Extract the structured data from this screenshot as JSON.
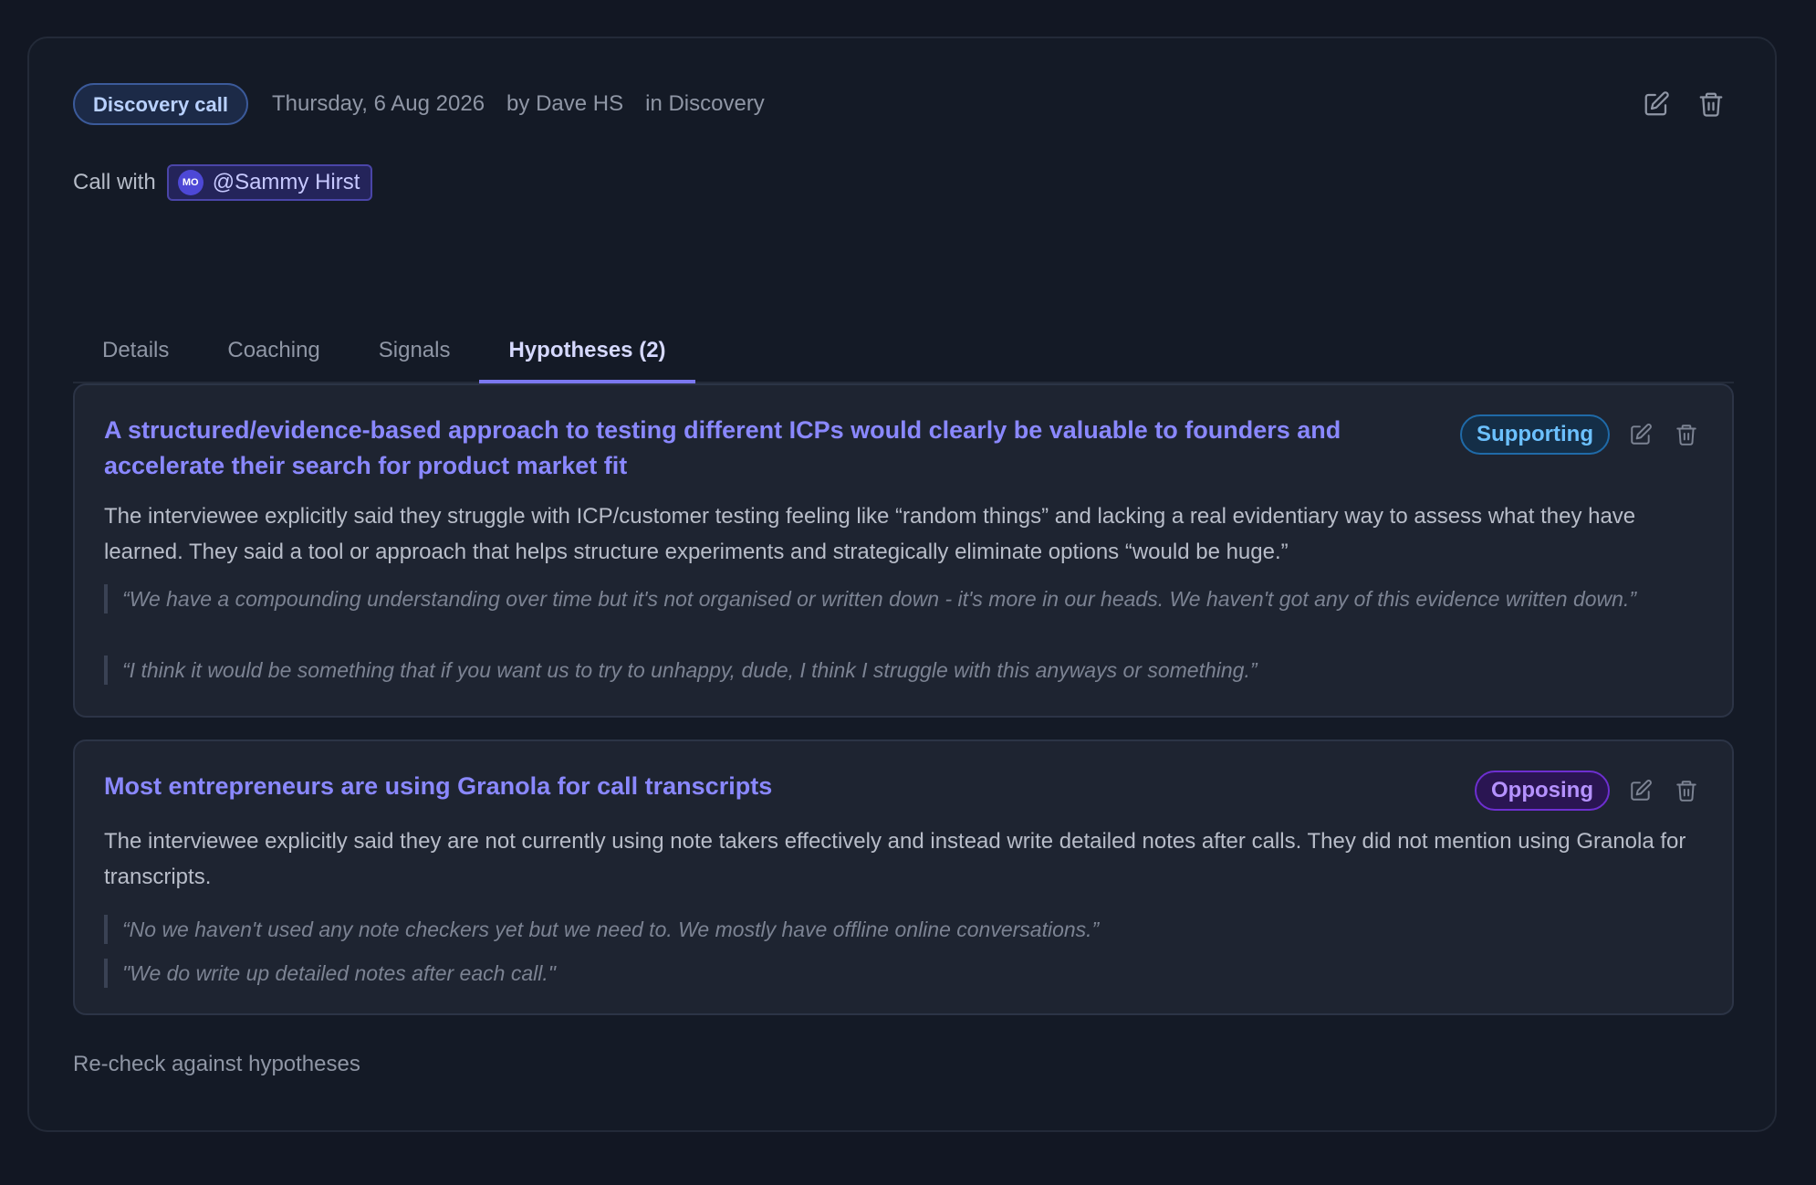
{
  "header": {
    "type_label": "Discovery call",
    "date": "Thursday, 6 Aug 2026",
    "author": "by Dave HS",
    "stage": "in Discovery"
  },
  "call_with": {
    "label": "Call with",
    "avatar_initials": "MO",
    "person": "@Sammy Hirst"
  },
  "tabs": [
    {
      "label": "Details"
    },
    {
      "label": "Coaching"
    },
    {
      "label": "Signals"
    },
    {
      "label": "Hypotheses (2)",
      "active": true
    }
  ],
  "hypotheses": [
    {
      "title": "A structured/evidence-based approach to testing different ICPs would clearly be valuable to founders and accelerate their search for product market fit",
      "stance": "Supporting",
      "summary": "The interviewee explicitly said they struggle with ICP/customer testing feeling like “random things” and lacking a real evidentiary way to assess what they have learned. They said a tool or approach that helps structure experiments and strategically eliminate options “would be huge.”",
      "quotes": [
        "“We have a compounding understanding over time but it's not organised or written down - it's more in our heads. We haven't got any of this evidence written down.”",
        "“I think it would be something that if you want us to try to unhappy, dude, I think I struggle with this anyways or something.”"
      ]
    },
    {
      "title": "Most entrepreneurs are using Granola for call transcripts",
      "stance": "Opposing",
      "summary": "The interviewee explicitly said they are not currently using note takers effectively and instead write detailed notes after calls. They did not mention using Granola for transcripts.",
      "quotes": [
        "“No we haven't used any note checkers yet but we need to. We mostly have offline online conversations.”",
        "\"We do write up detailed notes after each call.\""
      ]
    }
  ],
  "footer": {
    "recheck_label": "Re-check against hypotheses"
  },
  "colors": {
    "background": "#121723",
    "accent": "#8a88ff",
    "supporting": "#6cc1ff",
    "opposing": "#b592ff"
  },
  "icons": [
    "edit-icon",
    "trash-icon"
  ]
}
